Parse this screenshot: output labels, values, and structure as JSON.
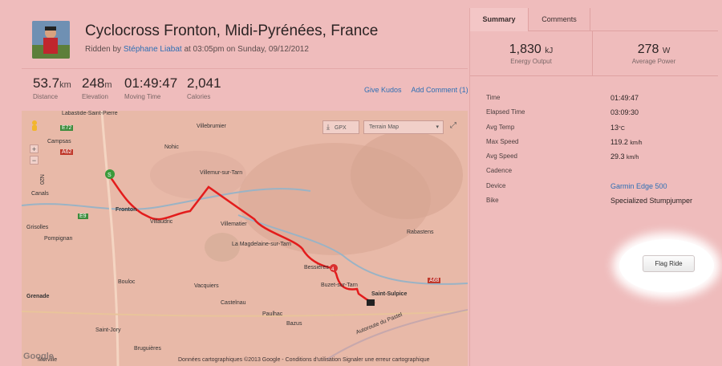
{
  "activity": {
    "title": "Cyclocross Fronton, Midi-Pyrénées, France",
    "ridden_by_prefix": "Ridden by",
    "rider": "Stéphane Liabat",
    "date_text": "at 03:05pm on Sunday, 09/12/2012"
  },
  "stats": [
    {
      "value": "53.7",
      "unit": "km",
      "label": "Distance"
    },
    {
      "value": "248",
      "unit": "m",
      "label": "Elevation"
    },
    {
      "value": "01:49:47",
      "unit": "",
      "label": "Moving Time"
    },
    {
      "value": "2,041",
      "unit": "",
      "label": "Calories"
    }
  ],
  "actions": {
    "kudos": "Give Kudos",
    "comment": "Add Comment (1)"
  },
  "map": {
    "gpx_label": "GPX",
    "map_type": "Terrain Map",
    "attribution": "Données cartographiques ©2013 Google - Conditions d'utilisation  Signaler une erreur cartographique",
    "google": "Google",
    "places": [
      "Labastide-Saint-Pierre",
      "Villebrumier",
      "Campsas",
      "Nohic",
      "Villemur-sur-Tarn",
      "Canals",
      "Fronton",
      "Villaudric",
      "Villematier",
      "Grisolles",
      "Pompignan",
      "La Magdelaine-sur-Tarn",
      "Rabastens",
      "Bessières",
      "Buzet-sur-Tarn",
      "Saint-Sulpice",
      "Bouloc",
      "Vacquiers",
      "Grenade",
      "Castelnau",
      "Paulhac",
      "Bazus",
      "Saint-Jory",
      "Bruguières",
      "Merville",
      "Autoroute du Pastel"
    ],
    "road_labels": [
      "E72",
      "A62",
      "E9",
      "A68",
      "N20"
    ],
    "route_markers": [
      "S",
      "4"
    ]
  },
  "sidebar": {
    "tabs": [
      "Summary",
      "Comments"
    ],
    "energy": {
      "value": "1,830",
      "unit": "kJ",
      "label": "Energy Output"
    },
    "power": {
      "value": "278",
      "unit": "W",
      "label": "Average Power"
    },
    "rows": [
      {
        "key": "Time",
        "value": "01:49:47",
        "unit": ""
      },
      {
        "key": "Elapsed Time",
        "value": "03:09:30",
        "unit": ""
      },
      {
        "key": "Avg Temp",
        "value": "13",
        "unit": "°C"
      },
      {
        "key": "Max Speed",
        "value": "119.2",
        "unit": "km/h"
      },
      {
        "key": "Avg Speed",
        "value": "29.3",
        "unit": "km/h"
      },
      {
        "key": "Cadence",
        "value": "",
        "unit": ""
      },
      {
        "key": "Device",
        "value": "Garmin Edge 500",
        "unit": ""
      },
      {
        "key": "Bike",
        "value": "Specialized Stumpjumper",
        "unit": ""
      }
    ],
    "flag_label": "Flag Ride"
  }
}
